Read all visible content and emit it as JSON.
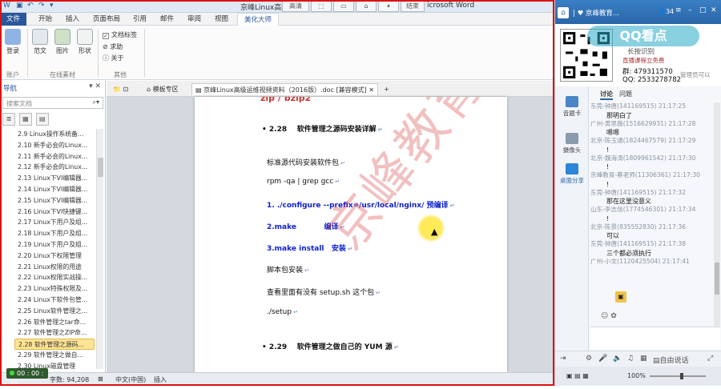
{
  "word": {
    "title": "京峰Linux高级运维视频资料（2016版）.doc [兼容模式] - Microsoft Word",
    "title_visible": "京峰Linux高级运",
    "title_suffix": "icrosoft Word",
    "floating_toolbar": [
      "高清",
      "结束"
    ],
    "tabs": [
      "文件",
      "开始",
      "插入",
      "页面布局",
      "引用",
      "邮件",
      "审阅",
      "视图",
      "美化大师"
    ],
    "ribbon": {
      "buttons": [
        "登录",
        "范文",
        "图片",
        "形状"
      ],
      "checks": [
        "文档标签",
        "求助",
        "关于"
      ],
      "groups": [
        "账户",
        "在线素材",
        "其他"
      ]
    },
    "nav": {
      "title": "导航",
      "search_placeholder": "搜索文档",
      "items": [
        "2.9 Linux操作系统备...",
        "2.10 新手必会的Linux...",
        "2.11 新手必会的Linux...",
        "2.12 新手必会的Linux...",
        "2.13 Linux下VI编辑器...",
        "2.14 Linux下VI编辑器...",
        "2.15 Linux下VI编辑器...",
        "2.16 Linux下VI快捷键...",
        "2.17 Linux下用户及组...",
        "2.18 Linux下用户及组...",
        "2.19 Linux下用户及组...",
        "2.20 Linux下权限管理",
        "2.21 Linux权限的用途",
        "2.22 Linux权限实战操...",
        "2.23 Linux特殊权限及...",
        "2.24 Linux下软件包管...",
        "2.25 Linux软件管理之...",
        "2.26 软件管理之tar命...",
        "2.27 软件管理之ZIP命...",
        "2.28 软件管理之源码...",
        "2.29 软件管理之做自...",
        "2.30 Linux磁盘管理"
      ]
    },
    "doctabs": [
      "模板专区",
      "京峰Linux高级运维视频资料（2016版）.doc [兼容模式]"
    ],
    "doc": {
      "top_cut": "zip / bzip2",
      "h1_num": "2.28",
      "h1": "软件管理之源码安装详解",
      "p1": "标准源代码安装软件包",
      "p2": "rpm -qa | grep gcc",
      "s1": "1. ./configure --prefix=/usr/local/nginx/  预编译",
      "s2a": "2.make",
      "s2b": "编译",
      "s3a": "3.make install",
      "s3b": "安装",
      "p3": "脚本包安装",
      "p4": "查看里面有没有 setup.sh 这个包",
      "p5": "./setup",
      "h2_num": "2.29",
      "h2": "软件管理之做自己的 YUM 源",
      "watermark": "京峰教育"
    },
    "status": {
      "page": "页面: 81/411",
      "words": "字数: 94,208",
      "lang": "中文(中国)",
      "mode": "插入",
      "rec_time": "00 : 00 : 33"
    }
  },
  "qq": {
    "title": "京峰教育...",
    "viewers": "34",
    "logo": "QQ看点",
    "banner": {
      "line1": "长按识别",
      "line2": "直播课程立免费",
      "group": "群: 479311570",
      "qq": "QQ: 2533278782",
      "admin": "管理员可以"
    },
    "left_items": [
      "音题卡",
      "摄像头",
      "桌面分享"
    ],
    "chat_tabs": [
      "讨论",
      "问题"
    ],
    "messages": [
      {
        "h": "东莞-钟唐(141169515) 21:17:25",
        "t": "那明白了"
      },
      {
        "h": "广州-黄思薇(1516629931) 21:17:28",
        "t": "嗯嗯"
      },
      {
        "h": "北京-陈玉通(1824467579) 21:17:29",
        "t": "!"
      },
      {
        "h": "北京-魏海涛(1809961542) 21:17:30",
        "t": "!"
      },
      {
        "h": "京峰教育-蔡老师(11306361) 21:17:30",
        "t": "!"
      },
      {
        "h": "东莞-钟唐(141169515) 21:17:32",
        "t": "那在这里没意义"
      },
      {
        "h": "山东-李志信(1774546301) 21:17:34",
        "t": "!"
      },
      {
        "h": "北京-陈景(835552830) 21:17:36",
        "t": "可以"
      },
      {
        "h": "东莞-钟唐(141169515) 21:17:38",
        "t": "三个都必须执行"
      },
      {
        "h": "广州-小文(1120425504) 21:17:41",
        "t": ""
      }
    ],
    "tools": [
      "自由说话"
    ],
    "zoom": "100%"
  }
}
